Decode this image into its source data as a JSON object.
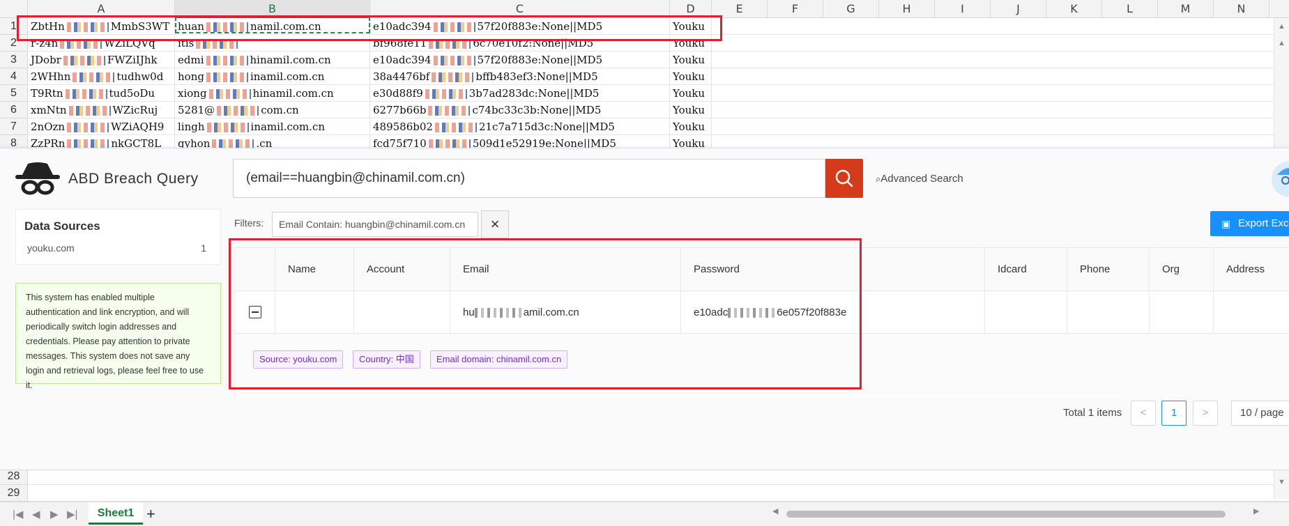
{
  "sheet": {
    "columns": [
      "A",
      "B",
      "C",
      "D",
      "E",
      "F",
      "G",
      "H",
      "I",
      "J",
      "K",
      "L",
      "M",
      "N"
    ],
    "rows": [
      {
        "num": "1",
        "a1": "ZbtHn",
        "a2": "MmbS3WT",
        "b1": "huan",
        "b2": "namil.com.cn",
        "c1": "e10adc394",
        "c2": "57f20f883e:None||MD5",
        "d": "Youku"
      },
      {
        "num": "2",
        "a1": "r-z4n",
        "a2": "WZiLQVq",
        "b1": "itis",
        "b2": "",
        "c1": "bf968fe11",
        "c2": "6c70e10f2:None||MD5",
        "d": "Youku"
      },
      {
        "num": "3",
        "a1": "JDobr",
        "a2": "FWZiIJhk",
        "b1": "edmi",
        "b2": "hinamil.com.cn",
        "c1": "e10adc394",
        "c2": "57f20f883e:None||MD5",
        "d": "Youku"
      },
      {
        "num": "4",
        "a1": "2WHhn",
        "a2": "tudhw0d",
        "b1": "hong",
        "b2": "inamil.com.cn",
        "c1": "38a4476bf",
        "c2": "bffb483ef3:None||MD5",
        "d": "Youku"
      },
      {
        "num": "5",
        "a1": "T9Rtn",
        "a2": "tud5oDu",
        "b1": "xiong",
        "b2": "hinamil.com.cn",
        "c1": "e30d88f9",
        "c2": "3b7ad283dc:None||MD5",
        "d": "Youku"
      },
      {
        "num": "6",
        "a1": "xmNtn",
        "a2": "WZicRuj",
        "b1": "5281@",
        "b2": "com.cn",
        "c1": "6277b66b",
        "c2": "c74bc33c3b:None||MD5",
        "d": "Youku"
      },
      {
        "num": "7",
        "a1": "2nOzn",
        "a2": "WZiAQH9",
        "b1": "lingh",
        "b2": "inamil.com.cn",
        "c1": "489586b02",
        "c2": "21c7a715d3c:None||MD5",
        "d": "Youku"
      },
      {
        "num": "8",
        "a1": "ZzPRn",
        "a2": "nkGCT8L",
        "b1": "gyhon",
        "b2": ".cn",
        "c1": "fcd75f710",
        "c2": "509d1e52919e:None||MD5",
        "d": "Youku"
      }
    ],
    "bottom_rows": [
      "28",
      "29"
    ],
    "sheet_tab": "Sheet1",
    "add_tab": "+"
  },
  "app": {
    "title": "ABD Breach Query",
    "search_value": "(email==huangbin@chinamil.com.cn)",
    "advanced_search": "Advanced Search",
    "data_sources_title": "Data Sources",
    "data_source": {
      "name": "youku.com",
      "count": "1"
    },
    "notice": "This system has enabled multiple authentication and link encryption, and will periodically switch login addresses and credentials. Please pay attention to private messages. This system does not save any login and retrieval logs, please feel free to use it.",
    "filters_label": "Filters:",
    "filter_chip": "Email Contain: huangbin@chinamil.com.cn",
    "export_label": "Export Exc",
    "table": {
      "headers": [
        "Name",
        "Account",
        "Email",
        "Password",
        "Idcard",
        "Phone",
        "Org",
        "Address"
      ],
      "row": {
        "name": "",
        "account": "",
        "email_start": "hu",
        "email_end": "amil.com.cn",
        "password_start": "e10adc",
        "password_end": "6e057f20f883e"
      },
      "tags": [
        "Source: youku.com",
        "Country: 中国",
        "Email domain: chinamil.com.cn"
      ]
    },
    "pagination": {
      "total": "Total 1 items",
      "prev": "<",
      "page": "1",
      "next": ">",
      "per_page": "10 / page"
    }
  }
}
